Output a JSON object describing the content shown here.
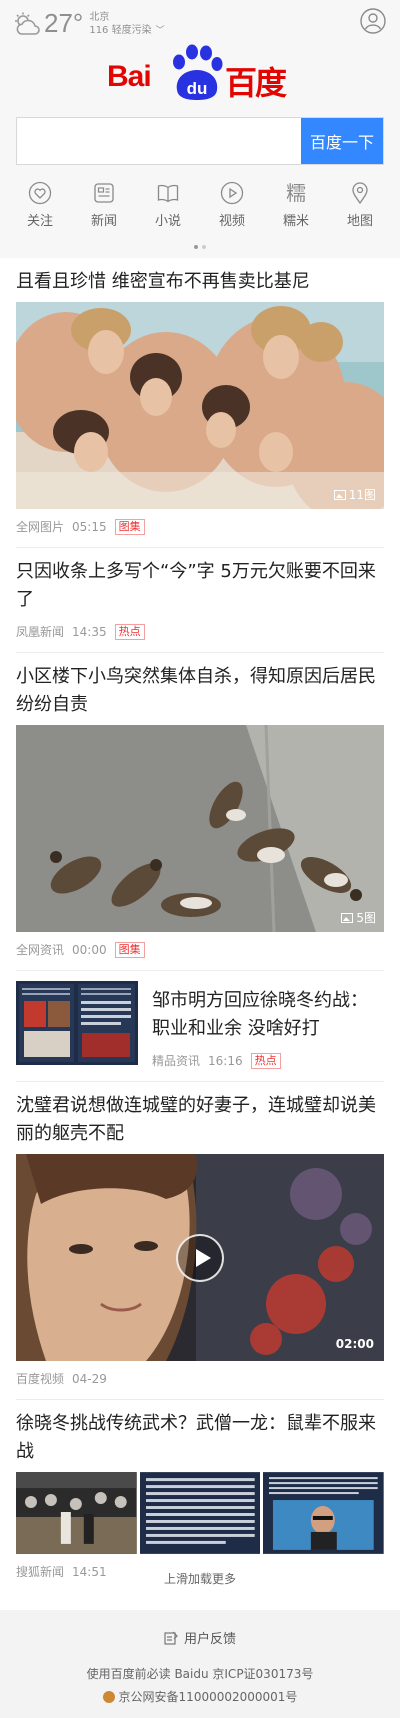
{
  "weather": {
    "temp": "27°",
    "city": "北京",
    "air": "116 轻度污染"
  },
  "logo": {
    "left": "Bai",
    "paw": "du",
    "right": "百度"
  },
  "search": {
    "value": "",
    "placeholder": "",
    "button": "百度一下"
  },
  "quick_links": [
    {
      "label": "关注",
      "icon": "heart-icon"
    },
    {
      "label": "新闻",
      "icon": "news-icon"
    },
    {
      "label": "小说",
      "icon": "book-icon"
    },
    {
      "label": "视频",
      "icon": "video-icon"
    },
    {
      "label": "糯米",
      "icon": "nuomi-icon"
    },
    {
      "label": "地图",
      "icon": "map-pin-icon"
    }
  ],
  "feed": [
    {
      "title": "且看且珍惜 维密宣布不再售卖比基尼",
      "source": "全网图片",
      "time": "05:15",
      "tag": "图集",
      "count": "11图"
    },
    {
      "title": "只因收条上多写个“今”字 5万元欠账要不回来了",
      "source": "凤凰新闻",
      "time": "14:35",
      "tag": "热点"
    },
    {
      "title": "小区楼下小鸟突然集体自杀，得知原因后居民纷纷自责",
      "source": "全网资讯",
      "time": "00:00",
      "tag": "图集",
      "count": "5图"
    },
    {
      "title": "邹市明方回应徐晓冬约战：职业和业余 没啥好打",
      "source": "精品资讯",
      "time": "16:16",
      "tag": "热点"
    },
    {
      "title": "沈璧君说想做连城璧的好妻子，连城璧却说美丽的躯壳不配",
      "source": "百度视频",
      "time": "04-29",
      "duration": "02:00"
    },
    {
      "title": "徐晓冬挑战传统武术？武僧一龙：鼠辈不服来战",
      "source": "搜狐新闻",
      "time": "14:51"
    }
  ],
  "load_more": "上滑加载更多",
  "footer": {
    "feedback": "用户反馈",
    "notice": "使用百度前必读 Baidu 京ICP证030173号",
    "beian": "京公网安备11000002000001号"
  },
  "colors": {
    "brand_red": "#e10602",
    "brand_blue": "#2932e1",
    "button_blue": "#3388ff",
    "tag_red": "#e33333"
  }
}
